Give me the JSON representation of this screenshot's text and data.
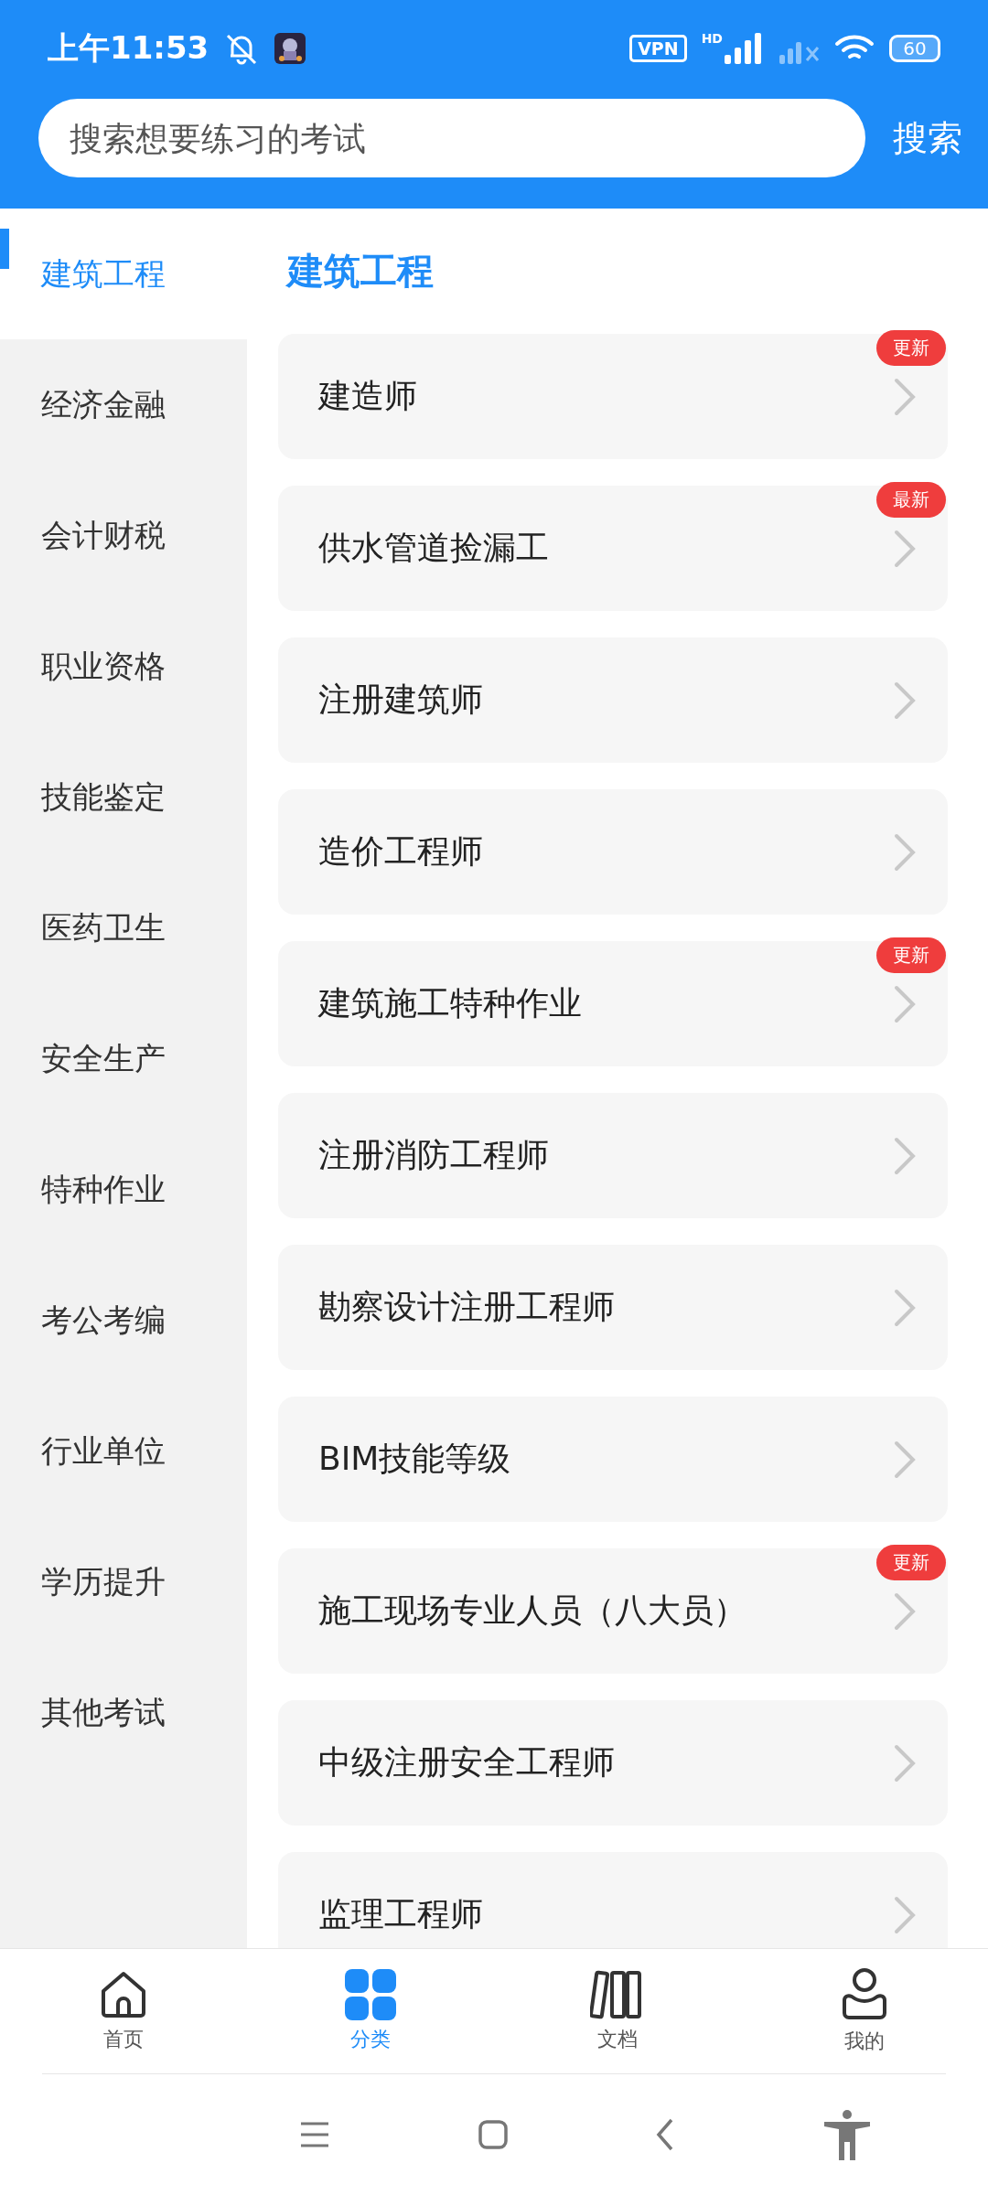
{
  "status_bar": {
    "time": "上午11:53",
    "vpn": "VPN",
    "network": "HD",
    "battery": "60"
  },
  "search": {
    "placeholder": "搜索想要练习的考试",
    "button": "搜索"
  },
  "sidebar": {
    "items": [
      {
        "label": "建筑工程",
        "selected": true
      },
      {
        "label": "经济金融",
        "selected": false
      },
      {
        "label": "会计财税",
        "selected": false
      },
      {
        "label": "职业资格",
        "selected": false
      },
      {
        "label": "技能鉴定",
        "selected": false
      },
      {
        "label": "医药卫生",
        "selected": false
      },
      {
        "label": "安全生产",
        "selected": false
      },
      {
        "label": "特种作业",
        "selected": false
      },
      {
        "label": "考公考编",
        "selected": false
      },
      {
        "label": "行业单位",
        "selected": false
      },
      {
        "label": "学历提升",
        "selected": false
      },
      {
        "label": "其他考试",
        "selected": false
      }
    ]
  },
  "section": {
    "title": "建筑工程",
    "items": [
      {
        "label": "建造师",
        "badge": "更新"
      },
      {
        "label": "供水管道捡漏工",
        "badge": "最新"
      },
      {
        "label": "注册建筑师"
      },
      {
        "label": "造价工程师"
      },
      {
        "label": "建筑施工特种作业",
        "badge": "更新"
      },
      {
        "label": "注册消防工程师"
      },
      {
        "label": "勘察设计注册工程师"
      },
      {
        "label": "BIM技能等级"
      },
      {
        "label": "施工现场专业人员（八大员）",
        "badge": "更新"
      },
      {
        "label": "中级注册安全工程师"
      },
      {
        "label": "监理工程师"
      }
    ]
  },
  "tab_bar": [
    {
      "kind": "home",
      "label": "首页",
      "selected": false
    },
    {
      "kind": "grid",
      "label": "分类",
      "selected": true
    },
    {
      "kind": "docs",
      "label": "文档",
      "selected": false
    },
    {
      "kind": "user",
      "label": "我的",
      "selected": false
    }
  ]
}
